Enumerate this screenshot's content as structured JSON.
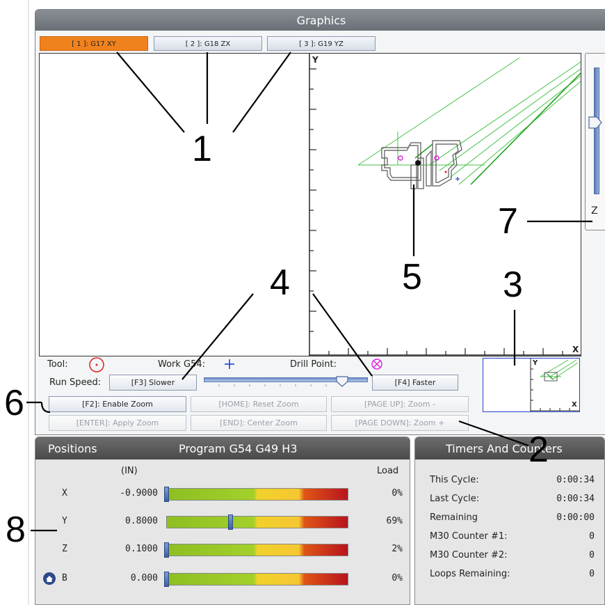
{
  "graphics": {
    "title": "Graphics",
    "tabs": [
      {
        "label": "[ 1 ]: G17 XY",
        "active": true
      },
      {
        "label": "[ 2 ]: G18 ZX",
        "active": false
      },
      {
        "label": "[ 3 ]: G19 YZ",
        "active": false
      }
    ],
    "axis_y_label": "Y",
    "axis_x_label": "X",
    "z_slider_label": "Z",
    "legend": {
      "tool_label": "Tool:",
      "work_label": "Work G54:",
      "drill_label": "Drill Point:",
      "tool_icon": "red-circle-dot-icon",
      "work_icon": "blue-plus-icon",
      "drill_icon": "magenta-circle-x-icon"
    },
    "run_speed": {
      "label": "Run Speed:",
      "slower": "[F3] Slower",
      "faster": "[F4] Faster",
      "level": 0.85
    },
    "zoom_buttons": [
      {
        "label": "[F2]: Enable Zoom",
        "enabled": true
      },
      {
        "label": "[HOME]: Reset Zoom",
        "enabled": false
      },
      {
        "label": "[PAGE UP]: Zoom -",
        "enabled": false
      },
      {
        "label": "[ENTER]: Apply Zoom",
        "enabled": false
      },
      {
        "label": "[END]: Center Zoom",
        "enabled": false
      },
      {
        "label": "[PAGE DOWN]: Zoom +",
        "enabled": false
      }
    ],
    "mini_view": {
      "y_label": "Y",
      "x_label": "X"
    }
  },
  "positions": {
    "title": "Positions",
    "program": "Program G54 G49 H3",
    "unit_header": "(IN)",
    "load_header": "Load",
    "home_icon": "home-icon",
    "axes": [
      {
        "axis": "X",
        "value": "-0.9000",
        "load": "0%",
        "load_fraction": 0.0
      },
      {
        "axis": "Y",
        "value": "0.8000",
        "load": "69%",
        "load_fraction": 0.35
      },
      {
        "axis": "Z",
        "value": "0.1000",
        "load": "2%",
        "load_fraction": 0.0
      },
      {
        "axis": "B",
        "value": "0.000",
        "load": "0%",
        "load_fraction": 0.0
      }
    ]
  },
  "timers": {
    "title": "Timers And Counters",
    "rows": [
      {
        "label": "This Cycle:",
        "value": "0:00:34"
      },
      {
        "label": "Last Cycle:",
        "value": "0:00:34"
      },
      {
        "label": "Remaining",
        "value": "0:00:00"
      },
      {
        "label": "M30 Counter #1:",
        "value": "0"
      },
      {
        "label": "M30 Counter #2:",
        "value": "0"
      },
      {
        "label": "Loops Remaining:",
        "value": "0"
      }
    ]
  },
  "callouts": [
    "1",
    "2",
    "3",
    "4",
    "5",
    "6",
    "7",
    "8"
  ]
}
